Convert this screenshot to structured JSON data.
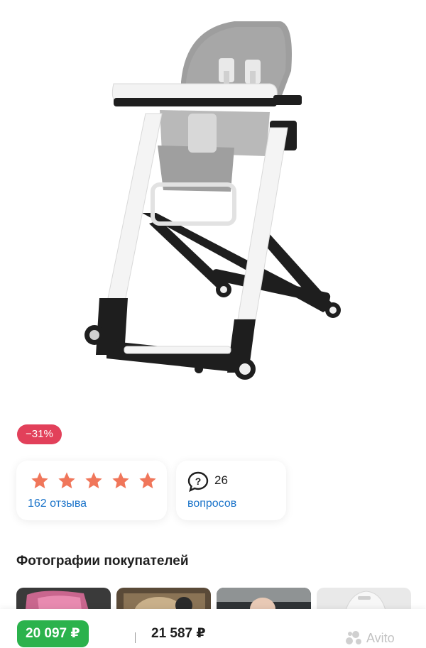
{
  "product": {
    "image_alt": "high-chair-photo",
    "discount_badge": "−31%"
  },
  "rating": {
    "stars": 5,
    "stars_max": 5,
    "reviews_label": "162 отзыва"
  },
  "questions": {
    "count": "26",
    "label": "вопросов"
  },
  "customer_photos": {
    "title": "Фотографии покупателей",
    "items": [
      "photo-1",
      "photo-2",
      "photo-3",
      "photo-4"
    ]
  },
  "bottom_bar": {
    "price": "20 097 ₽",
    "old_price": "21 587 ₽",
    "watermark": "Avito"
  },
  "colors": {
    "discount": "#e2405a",
    "star": "#f0765a",
    "link": "#1a73c9",
    "price": "#2bb24c"
  }
}
